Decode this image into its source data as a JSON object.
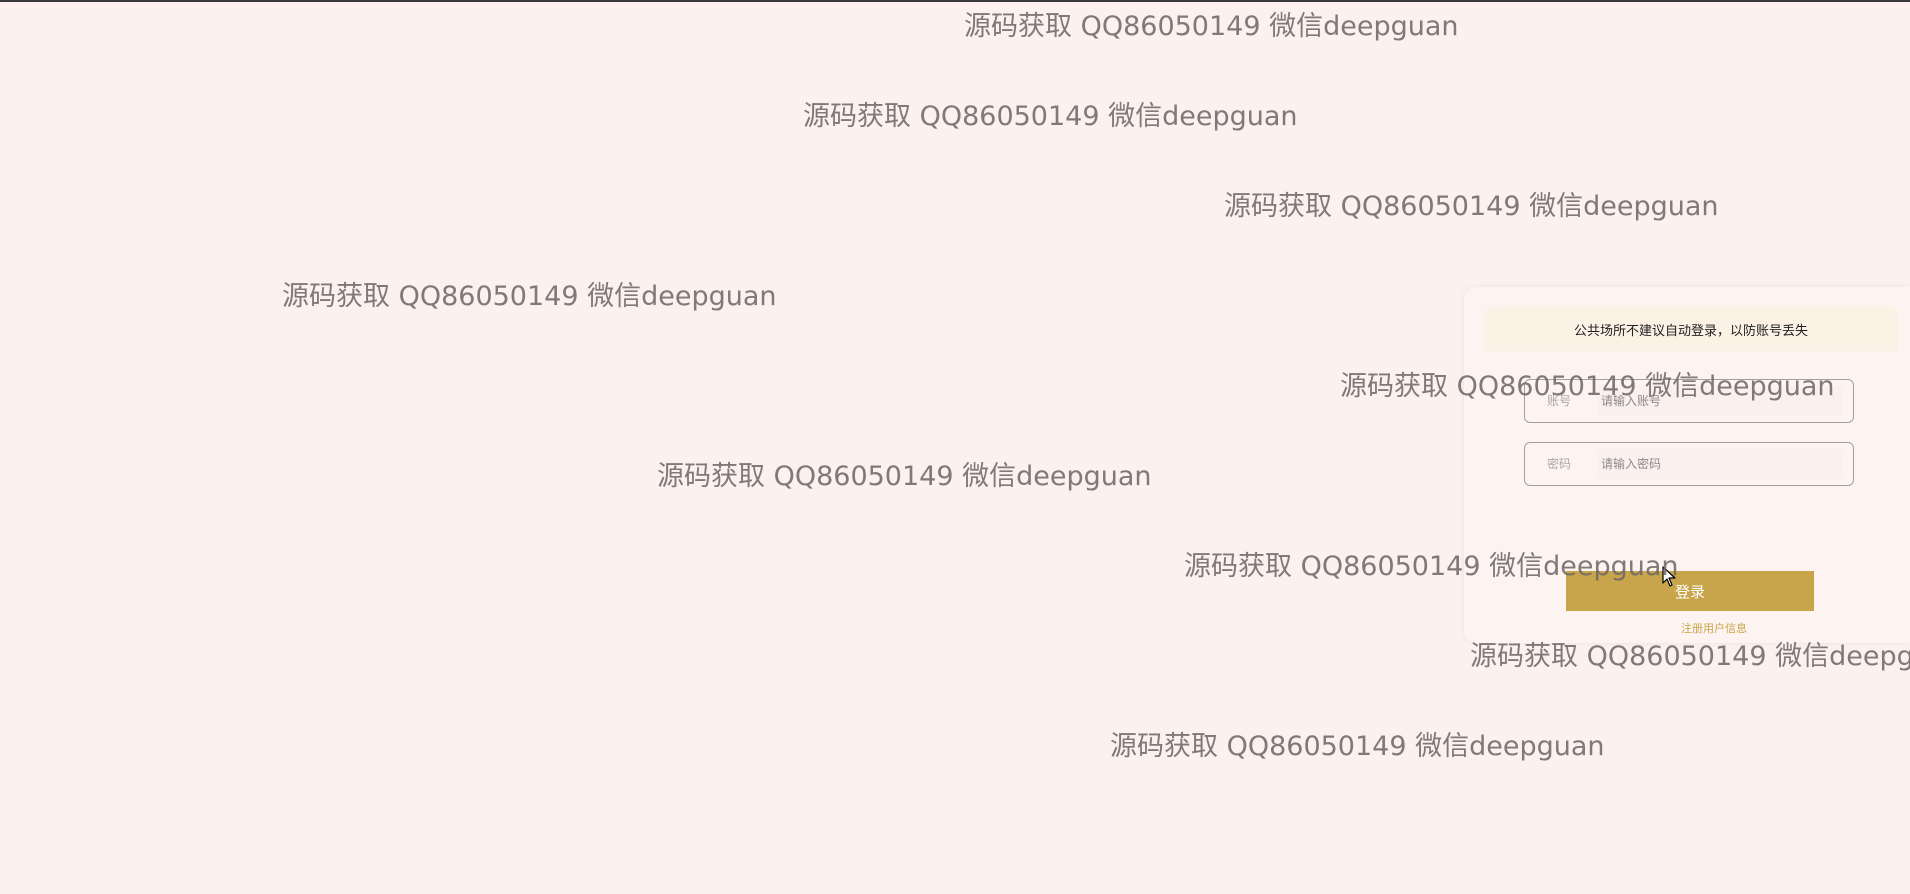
{
  "login": {
    "notice": "公共场所不建议自动登录，以防账号丢失",
    "account": {
      "label": "账号",
      "placeholder": "请输入账号"
    },
    "password": {
      "label": "密码",
      "placeholder": "请输入密码"
    },
    "login_button": "登录",
    "register_link": "注册用户信息"
  },
  "watermark": {
    "text": "源码获取 QQ86050149 微信deepguan"
  },
  "colors": {
    "background": "#fdf1ef",
    "accent": "#c8a54a",
    "notice_bg": "#fbf1e4"
  }
}
